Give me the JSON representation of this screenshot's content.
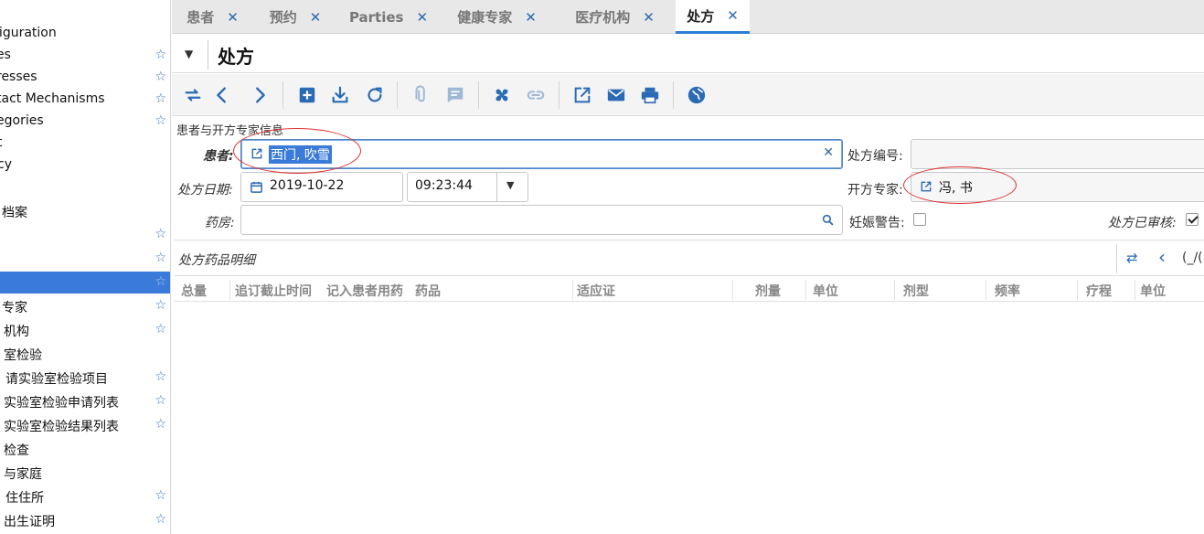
{
  "sidebar": {
    "items": [
      {
        "text": "figuration",
        "star": false
      },
      {
        "text": "es",
        "star": true
      },
      {
        "text": "resses",
        "star": true
      },
      {
        "text": "tact Mechanisms",
        "star": true
      },
      {
        "text": "egories",
        "star": true
      },
      {
        "text": "t",
        "star": false
      },
      {
        "text": "cy",
        "star": false
      },
      {
        "text": "",
        "star": false
      },
      {
        "text": "档案",
        "star": false
      },
      {
        "text": "",
        "star": true
      },
      {
        "text": "",
        "star": true
      },
      {
        "text": "",
        "star": true,
        "selected": true
      },
      {
        "text": "专家",
        "star": true
      },
      {
        "text": "机构",
        "star": true
      },
      {
        "text": "室检验",
        "star": false
      },
      {
        "text": "请实验室检验项目",
        "star": true
      },
      {
        "text": "实验室检验申请列表",
        "star": true
      },
      {
        "text": "实验室检验结果列表",
        "star": true
      },
      {
        "text": "检查",
        "star": false
      },
      {
        "text": "与家庭",
        "star": false
      },
      {
        "text": "住住所",
        "star": true
      },
      {
        "text": "出生证明",
        "star": true
      }
    ],
    "star_glyph": "☆"
  },
  "tabs": [
    {
      "label": "患者",
      "close": "✕"
    },
    {
      "label": "预约",
      "close": "✕"
    },
    {
      "label": "Parties",
      "close": "✕"
    },
    {
      "label": "健康专家",
      "close": "✕"
    },
    {
      "label": "医疗机构",
      "close": "✕"
    },
    {
      "label": "处方",
      "close": "✕",
      "active": true
    }
  ],
  "header": {
    "caret": "▼",
    "title": "处方"
  },
  "toolbar": {
    "icons": [
      "switch-view-icon",
      "previous-icon",
      "next-icon",
      "new-record-icon",
      "save-icon",
      "reload-icon",
      "attachment-icon",
      "note-icon",
      "action-icon",
      "relate-icon",
      "open-report-icon",
      "email-icon",
      "print-icon",
      "web-icon"
    ]
  },
  "form": {
    "section_label": "患者与开方专家信息",
    "patient_label": "患者:",
    "patient_value": "西门, 吹雪",
    "clear_glyph": "✕",
    "prescription_no_label": "处方编号:",
    "prescription_no_value": "",
    "date_label": "处方日期:",
    "date_value": "2019-10-22",
    "time_value": "09:23:44",
    "prescriber_label": "开方专家:",
    "prescriber_value": "冯, 书",
    "pharmacy_label": "药房:",
    "pharmacy_value": "",
    "pregnancy_label": "妊娠警告:",
    "pregnancy_checked": false,
    "reviewed_label": "处方已审核:",
    "reviewed_checked": true
  },
  "detail": {
    "title": "处方药品明细",
    "nav_switch": "⇄",
    "nav_prev": "‹",
    "count": "(_/(",
    "columns": [
      "总量",
      "追订截止时间",
      "记入患者用药",
      "药品",
      "适应证",
      "剂量",
      "单位",
      "剂型",
      "频率",
      "疗程",
      "单位"
    ]
  },
  "colors": {
    "accent": "#2a7fd4",
    "selected": "#3a7ad8",
    "annotation": "#e03030",
    "icon": "#2a6bb4"
  }
}
